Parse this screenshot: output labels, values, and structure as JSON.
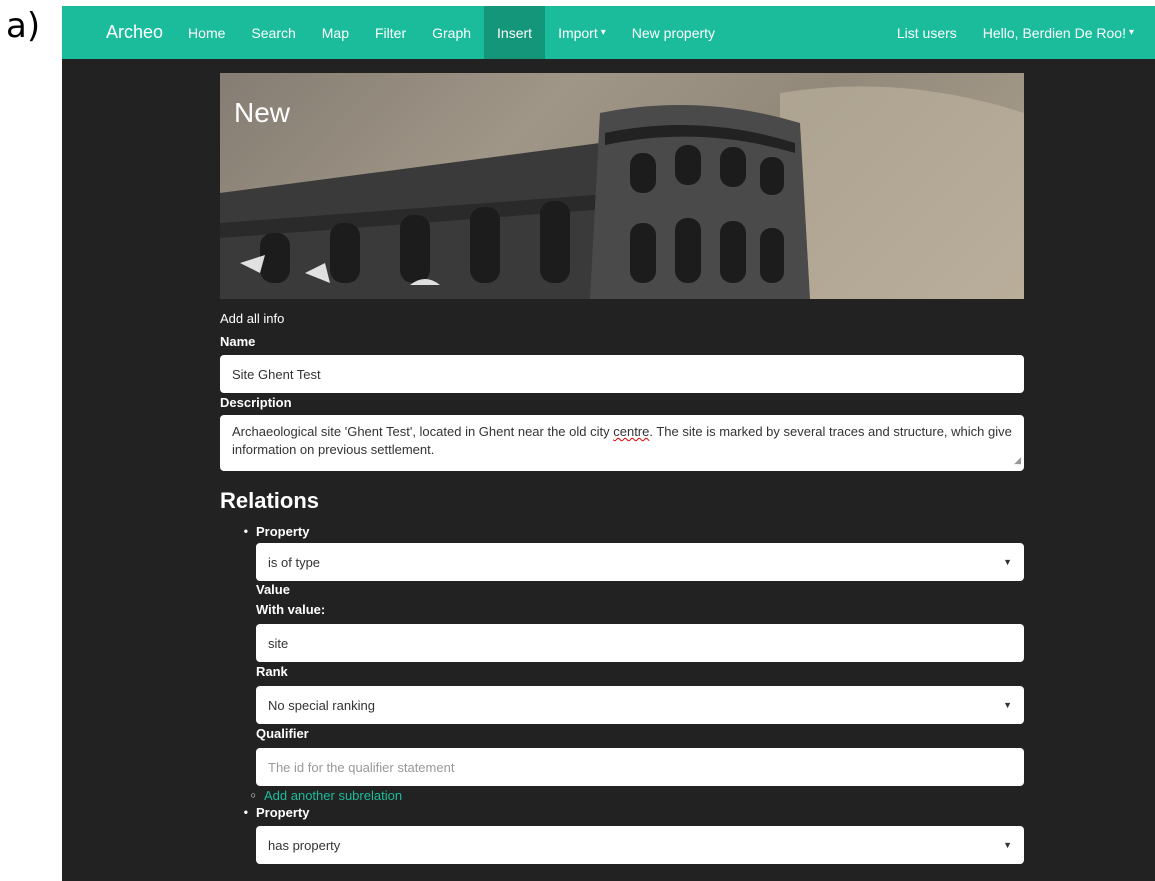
{
  "figure_label": "a)",
  "navbar": {
    "brand": "Archeo",
    "items": [
      "Home",
      "Search",
      "Map",
      "Filter",
      "Graph",
      "Insert",
      "Import",
      "New property"
    ],
    "active": "Insert",
    "right_items": [
      "List users",
      "Hello, Berdien De Roo!"
    ]
  },
  "hero": {
    "title": "New"
  },
  "form": {
    "intro": "Add all info",
    "name_label": "Name",
    "name_value": "Site Ghent Test",
    "description_label": "Description",
    "description_before": "Archaeological site 'Ghent Test', located in Ghent near the old city ",
    "description_misspelled": "centre",
    "description_after": ". The site is marked by several traces and structure, which give information on previous settlement."
  },
  "relations": {
    "title": "Relations",
    "property_label": "Property",
    "property_value": "is of type",
    "value_label": "Value",
    "with_value_label": "With value:",
    "with_value": "site",
    "rank_label": "Rank",
    "rank_value": "No special ranking",
    "qualifier_label": "Qualifier",
    "qualifier_placeholder": "The id for the qualifier statement",
    "add_subrelation": "Add another subrelation",
    "property2_label": "Property",
    "property2_value": "has property"
  },
  "colors": {
    "navbar": "#1abc9c",
    "navbar_active": "#139679",
    "background": "#222222",
    "link": "#1abc9c"
  },
  "icons": {
    "dropdown": "caret-down-icon",
    "select_arrow": "select-arrow-icon"
  }
}
